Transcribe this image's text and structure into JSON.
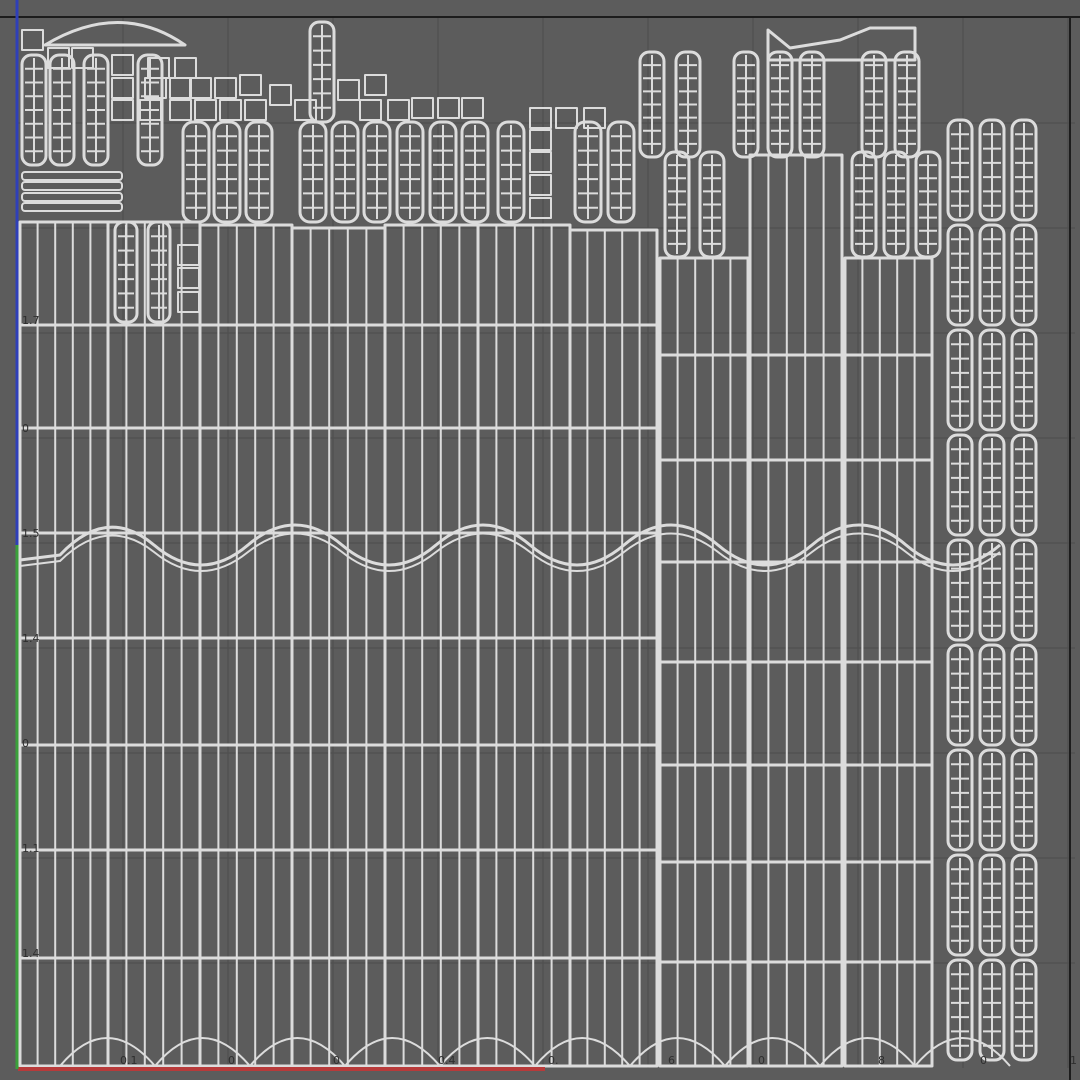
{
  "editor": {
    "title": "",
    "view": "uv-editor",
    "colors": {
      "background": "#5c5c5c",
      "grid": "#4d4d4d",
      "frame": "#1c1c1c",
      "wire": "#dcdcdc",
      "axis_u": "#b83a3a",
      "axis_v": "#3aa03a",
      "axis_w": "#2f3fb8"
    }
  },
  "grid": {
    "u_labels": [
      "0.1",
      "0",
      "0",
      "0.4",
      "0.",
      "6",
      "0",
      "8",
      "0"
    ],
    "v_labels": [
      "1.7",
      "0",
      "1.5",
      "1.4",
      "0",
      "1.1",
      "1.4"
    ],
    "corner_label": "1"
  }
}
